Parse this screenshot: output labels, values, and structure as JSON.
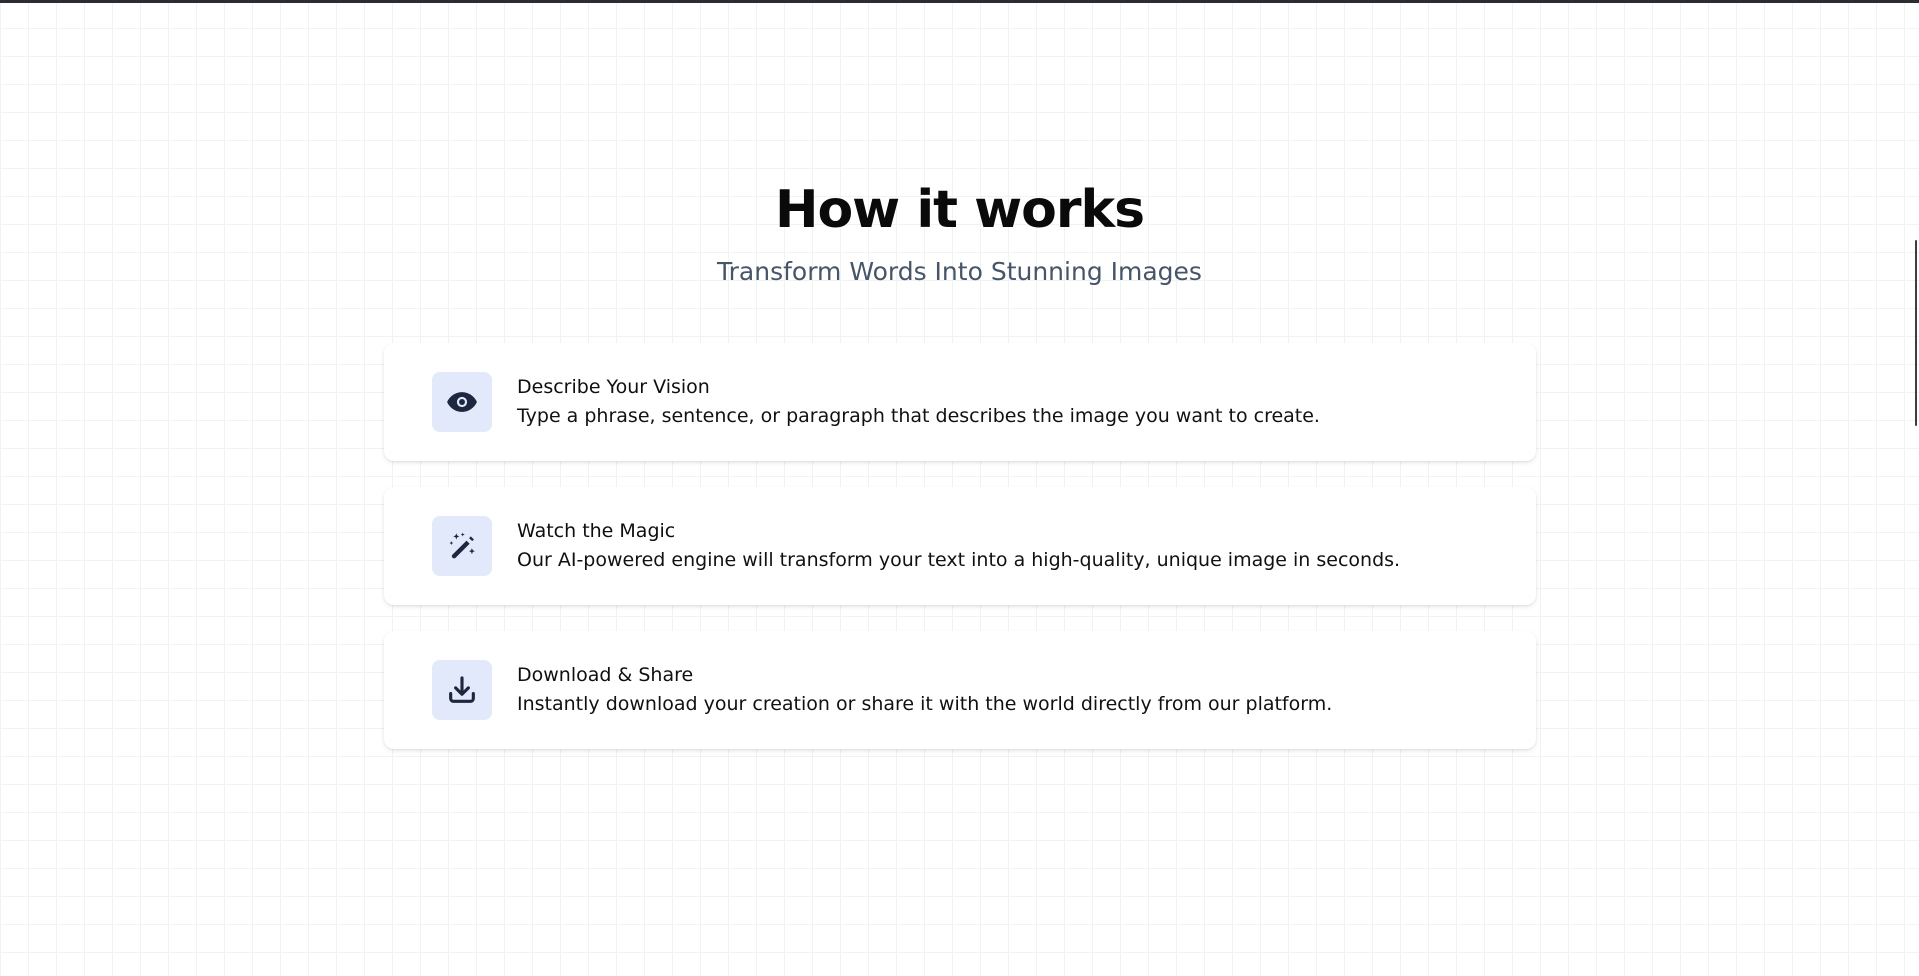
{
  "section": {
    "title": "How it works",
    "subtitle": "Transform Words Into Stunning Images"
  },
  "steps": [
    {
      "icon": "eye-icon",
      "title": "Describe Your Vision",
      "description": "Type a phrase, sentence, or paragraph that describes the image you want to create."
    },
    {
      "icon": "magic-wand-icon",
      "title": "Watch the Magic",
      "description": "Our AI-powered engine will transform your text into a high-quality, unique image in seconds."
    },
    {
      "icon": "download-icon",
      "title": "Download & Share",
      "description": "Instantly download your creation or share it with the world directly from our platform."
    }
  ],
  "colors": {
    "icon_background": "#e2e9fb",
    "icon_foreground": "#1e2740",
    "subtitle": "#475569"
  }
}
